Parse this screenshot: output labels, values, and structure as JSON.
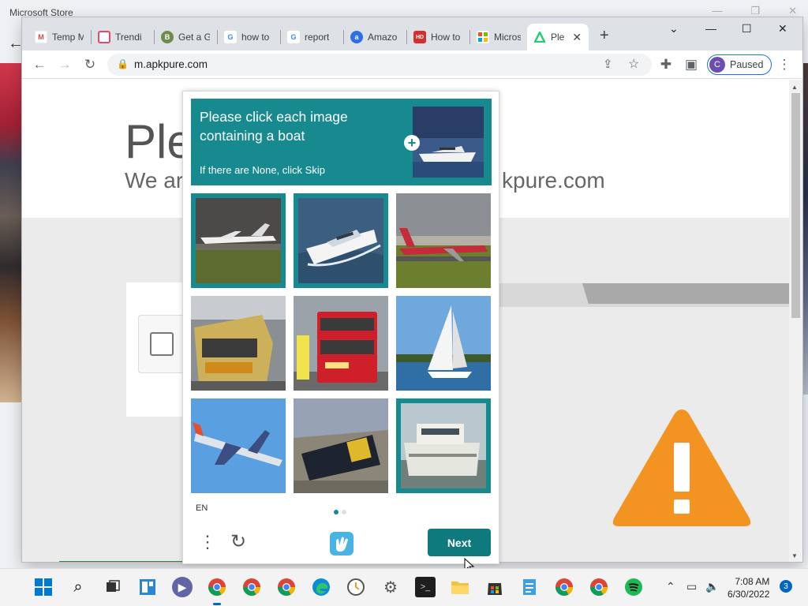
{
  "background_window": {
    "title": "Microsoft Store"
  },
  "browser": {
    "tabs": [
      {
        "label": "Temp M",
        "icon": "gmail-icon",
        "color": "#ea4335"
      },
      {
        "label": "Trendi",
        "icon": "trending-icon",
        "color": "#e24a6c"
      },
      {
        "label": "Get a G",
        "icon": "gcard-icon",
        "color": "#34a853"
      },
      {
        "label": "how to",
        "icon": "google-icon",
        "color": "#4285f4"
      },
      {
        "label": "report",
        "icon": "google-icon",
        "color": "#4285f4"
      },
      {
        "label": "Amazo",
        "icon": "amazon-icon",
        "color": "#2f6ee8"
      },
      {
        "label": "How to",
        "icon": "video-icon",
        "color": "#d32f2f"
      },
      {
        "label": "Micros",
        "icon": "microsoft-icon",
        "color": "#f25022"
      },
      {
        "label": "Ple",
        "icon": "apkpure-icon",
        "color": "#24cd77",
        "active": true
      }
    ],
    "url": "m.apkpure.com",
    "profile": {
      "initial": "C",
      "status": "Paused"
    }
  },
  "page": {
    "title": "Ple",
    "subtitle_left": "We ar",
    "subtitle_right": "kpure.com"
  },
  "captcha": {
    "prompt": "Please click each image containing a boat",
    "skip_hint": "If there are None, click Skip",
    "language": "EN",
    "next_label": "Next",
    "accent_color": "#168a8f",
    "tiles": [
      {
        "subject": "private jet on runway",
        "selected": true
      },
      {
        "subject": "motor yacht on water",
        "selected": true
      },
      {
        "subject": "airliner on runway",
        "selected": false
      },
      {
        "subject": "passenger train",
        "selected": false
      },
      {
        "subject": "red double-decker bus",
        "selected": false
      },
      {
        "subject": "sailboat",
        "selected": false
      },
      {
        "subject": "airliner in flight",
        "selected": false
      },
      {
        "subject": "freight locomotive",
        "selected": false
      },
      {
        "subject": "houseboat",
        "selected": true
      }
    ]
  },
  "taskbar": {
    "time": "7:08 AM",
    "date": "6/30/2022",
    "notification_count": "3"
  }
}
